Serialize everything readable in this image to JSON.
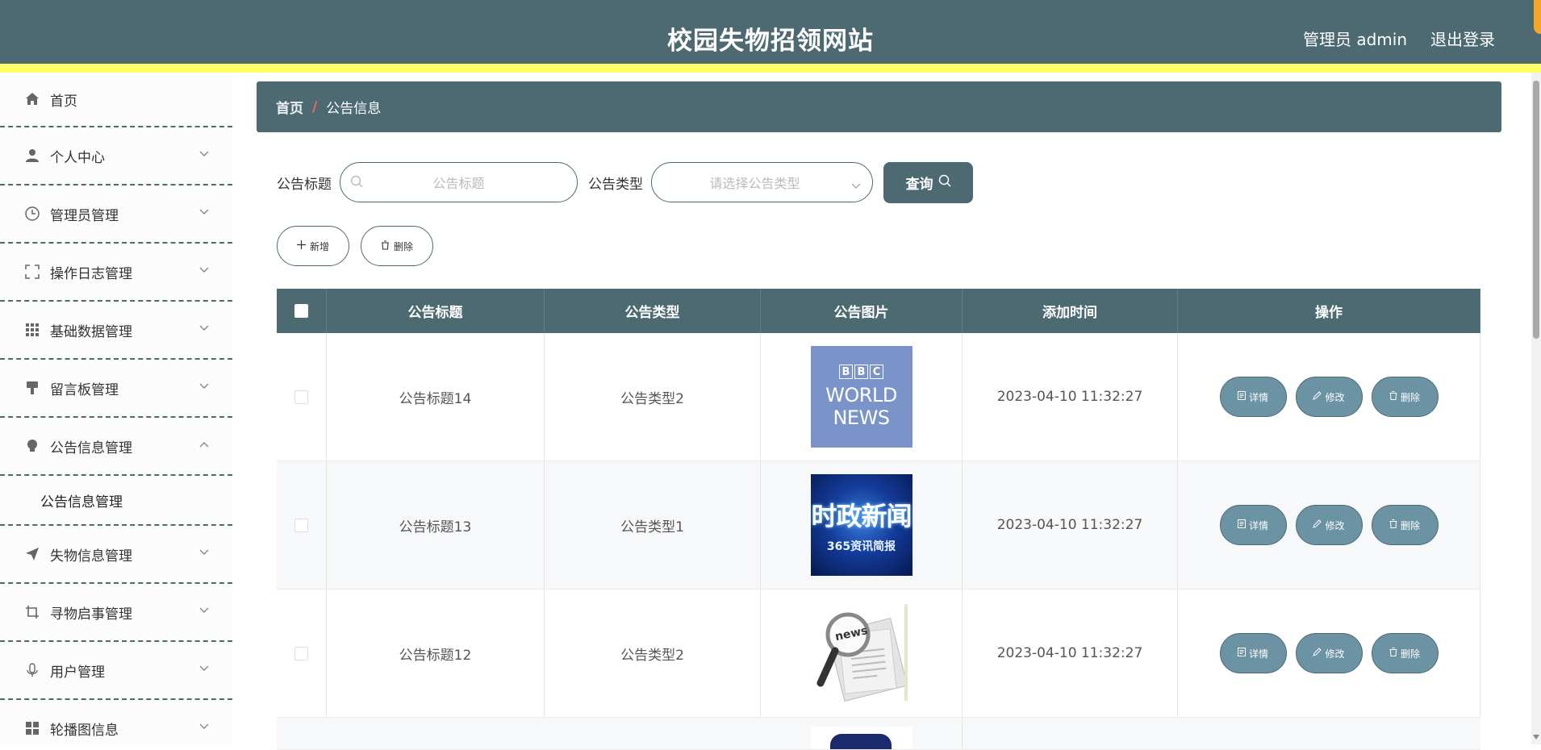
{
  "header": {
    "title": "校园失物招领网站",
    "user": "管理员 admin",
    "logout": "退出登录"
  },
  "sidebar": {
    "items": [
      {
        "label": "首页",
        "icon": "home-icon"
      },
      {
        "label": "个人中心",
        "icon": "user-icon"
      },
      {
        "label": "管理员管理",
        "icon": "clock-icon"
      },
      {
        "label": "操作日志管理",
        "icon": "fullscreen-icon"
      },
      {
        "label": "基础数据管理",
        "icon": "grid-icon"
      },
      {
        "label": "留言板管理",
        "icon": "brush-icon"
      },
      {
        "label": "公告信息管理",
        "icon": "bulb-icon"
      },
      {
        "label": "失物信息管理",
        "icon": "send-icon"
      },
      {
        "label": "寻物启事管理",
        "icon": "crop-icon"
      },
      {
        "label": "用户管理",
        "icon": "microphone-icon"
      },
      {
        "label": "轮播图信息",
        "icon": "menu-icon"
      }
    ],
    "submenu": {
      "label": "公告信息管理"
    }
  },
  "breadcrumb": {
    "home": "首页",
    "separator": "/",
    "current": "公告信息"
  },
  "search": {
    "title_label": "公告标题",
    "title_placeholder": "公告标题",
    "type_label": "公告类型",
    "type_placeholder": "请选择公告类型",
    "query_label": "查询"
  },
  "actions": {
    "add_label": "新增",
    "delete_label": "删除"
  },
  "table": {
    "columns": [
      "公告标题",
      "公告类型",
      "公告图片",
      "添加时间",
      "操作"
    ],
    "rows": [
      {
        "title": "公告标题14",
        "type": "公告类型2",
        "time": "2023-04-10 11:32:27",
        "image": "bbc-world-news"
      },
      {
        "title": "公告标题13",
        "type": "公告类型1",
        "time": "2023-04-10 11:32:27",
        "image": "shizheng-news"
      },
      {
        "title": "公告标题12",
        "type": "公告类型2",
        "time": "2023-04-10 11:32:27",
        "image": "magnifier-news"
      }
    ],
    "op_labels": {
      "detail": "详情",
      "edit": "修改",
      "delete": "删除"
    },
    "images": {
      "bbc": {
        "letters": [
          "B",
          "B",
          "C"
        ],
        "line1": "WORLD",
        "line2": "NEWS"
      },
      "news": {
        "big": "时政新闻",
        "small": "365资讯简报"
      },
      "mag": {
        "word": "news"
      }
    }
  },
  "colors": {
    "primary": "#4d6a73",
    "accent": "#ffff66",
    "button": "#6b93a3",
    "separator": "#f56c6c"
  }
}
